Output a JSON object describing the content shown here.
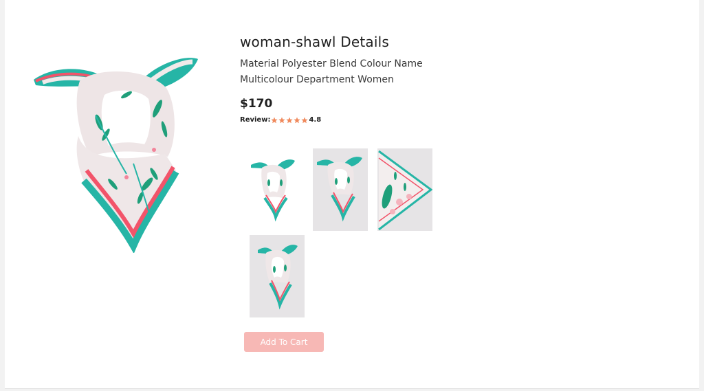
{
  "product": {
    "title": "woman-shawl Details",
    "description": "Material Polyester Blend Colour Name Multicolour Department Women",
    "price": "$170",
    "review_label": "Review:",
    "rating": "4.8",
    "stars": 5
  },
  "colors": {
    "accent": "#f7b8b5",
    "star": "#f08a5d",
    "scarf_teal": "#26b5a6",
    "scarf_pink": "#f2546a"
  },
  "thumbnails": [
    {
      "alt": "shawl tied view",
      "icon": "scarf-tied-image"
    },
    {
      "alt": "shawl on grey",
      "icon": "scarf-tied-image"
    },
    {
      "alt": "shawl flat pattern",
      "icon": "scarf-flat-image"
    },
    {
      "alt": "shawl on grey tall",
      "icon": "scarf-tied-image"
    }
  ],
  "actions": {
    "add_to_cart": "Add To Cart"
  }
}
